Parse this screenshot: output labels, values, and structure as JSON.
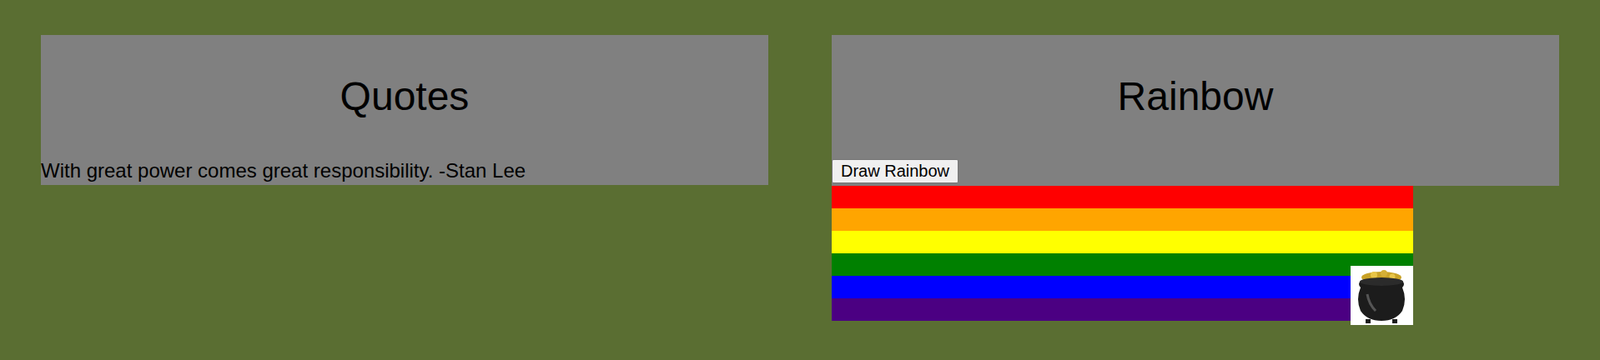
{
  "quotes_panel": {
    "title": "Quotes",
    "quote": "With great power comes great responsibility. -Stan Lee"
  },
  "rainbow_panel": {
    "title": "Rainbow",
    "button": "Draw Rainbow",
    "stripes": [
      {
        "color": "#ff0000"
      },
      {
        "color": "#ffa500"
      },
      {
        "color": "#ffff00"
      },
      {
        "color": "#008000"
      },
      {
        "color": "#0000ff"
      },
      {
        "color": "#4b0082"
      }
    ]
  }
}
